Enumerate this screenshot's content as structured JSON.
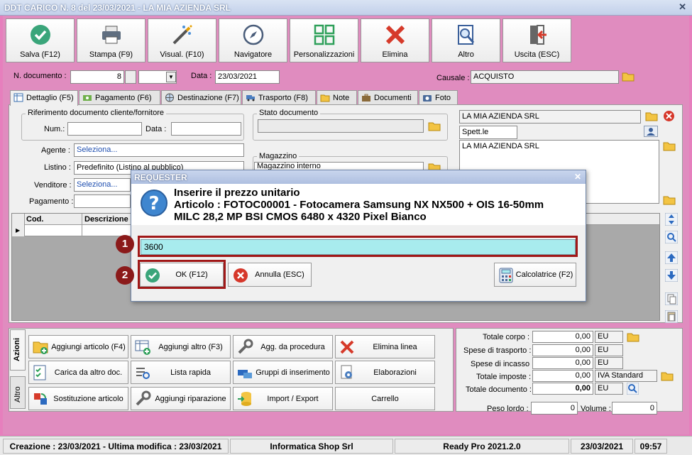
{
  "window": {
    "title": "DDT CARICO N. 8 del 23/03/2021 - LA MIA AZIENDA SRL"
  },
  "toolbar": {
    "save": "Salva (F12)",
    "print": "Stampa (F9)",
    "view": "Visual. (F10)",
    "navigator": "Navigatore",
    "custom": "Personalizzazioni",
    "delete": "Elimina",
    "other": "Altro",
    "exit": "Uscita (ESC)"
  },
  "header": {
    "doc_label": "N. documento :",
    "doc_value": "8",
    "date_label": "Data :",
    "date_value": "23/03/2021",
    "causale_label": "Causale :",
    "causale_value": "ACQUISTO"
  },
  "tabs": [
    "Dettaglio (F5)",
    "Pagamento (F6)",
    "Destinazione (F7)",
    "Trasporto (F8)",
    "Note",
    "Documenti",
    "Foto"
  ],
  "riferimento": {
    "title": "Riferimento documento cliente/fornitore",
    "num_label": "Num.:",
    "data_label": "Data :"
  },
  "stato": {
    "title": "Stato documento"
  },
  "magazzino": {
    "title": "Magazzino",
    "value": "Magazzino interno"
  },
  "agente": {
    "label": "Agente :",
    "value": "Seleziona..."
  },
  "listino": {
    "label": "Listino :",
    "value": "Predefinito (Listino al pubblico)"
  },
  "venditore": {
    "label": "Venditore :",
    "value": "Seleziona..."
  },
  "pagamento": {
    "label": "Pagamento :"
  },
  "cliente": {
    "name": "LA MIA AZIENDA SRL",
    "title": "Spett.le",
    "address": "LA MIA AZIENDA SRL"
  },
  "grid": {
    "columns": [
      "Cod.",
      "Descrizione"
    ]
  },
  "side_tabs": [
    "Azioni",
    "Altro"
  ],
  "actions": [
    "Aggiungi articolo (F4)",
    "Aggiungi altro (F3)",
    "Agg. da procedura",
    "Elimina linea",
    "Carica da altro doc.",
    "Lista rapida",
    "Gruppi di inserimento",
    "Elaborazioni",
    "Sostituzione articolo",
    "Aggiungi riparazione",
    "Import / Export",
    "Carrello"
  ],
  "totals": {
    "corpo_label": "Totale corpo :",
    "corpo_value": "0,00",
    "corpo_cur": "EU",
    "trasp_label": "Spese di trasporto :",
    "trasp_value": "0,00",
    "trasp_cur": "EU",
    "inc_label": "Spese di incasso :",
    "inc_value": "0,00",
    "inc_cur": "EU",
    "imp_label": "Totale imposte :",
    "imp_value": "0,00",
    "imp_cur": "IVA Standard",
    "doc_label": "Totale documento :",
    "doc_value": "0,00",
    "doc_cur": "EU",
    "peso_label": "Peso lordo :",
    "peso_value": "0",
    "vol_label": "Volume :",
    "vol_value": "0"
  },
  "status": {
    "created": "Creazione : 23/03/2021 - Ultima modifica : 23/03/2021",
    "company": "Informatica Shop Srl",
    "version": "Ready Pro 2021.2.0",
    "date": "23/03/2021",
    "time": "09:57"
  },
  "dialog": {
    "title": "REQUESTER",
    "line1": "Inserire il prezzo unitario",
    "line2": "Articolo : FOTOC00001 - Fotocamera Samsung NX NX500 + OIS 16-50mm",
    "line3": "MILC 28,2 MP BSI CMOS 6480 x 4320 Pixel Bianco",
    "value": "3600",
    "ok": "OK (F12)",
    "cancel": "Annulla (ESC)",
    "calc": "Calcolatrice (F2)"
  },
  "markers": [
    "1",
    "2"
  ],
  "colors": {
    "frame": "#e08cbf",
    "accent": "#3a78c2",
    "marker": "#8b1a1a",
    "input_highlight": "#a8ecee"
  }
}
